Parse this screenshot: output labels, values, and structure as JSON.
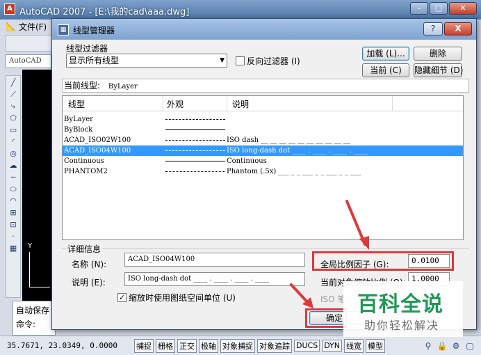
{
  "app": {
    "title": "AutoCAD 2007 - [E:\\我的cad\\aaa.dwg]",
    "menu_file": "文件(F)",
    "style_box": "AutoCAD",
    "y_axis": "Y"
  },
  "command_area": {
    "line1": "自动保存",
    "line2": "命令:"
  },
  "status_bar": {
    "coords": "35.7671, 23.0349, 0.0000",
    "buttons": [
      "捕捉",
      "栅格",
      "正交",
      "极轴",
      "对象捕捉",
      "对象追踪",
      "DUCS",
      "DYN",
      "线宽",
      "模型"
    ]
  },
  "dialog": {
    "title": "线型管理器",
    "filter_label": "线型过滤器",
    "filter_value": "显示所有线型",
    "invert_filter": "反向过滤器 (I)",
    "load_button": "加载 (L)...",
    "delete_button": "删除",
    "current_button": "当前 (C)",
    "hide_details_button": "隐藏细节 (D)",
    "current_linetype_label": "当前线型:",
    "current_linetype_value": "ByLayer",
    "columns": {
      "linetype": "线型",
      "appearance": "外观",
      "description": "说明"
    },
    "rows": [
      {
        "name": "ByLayer",
        "pattern": "dash",
        "desc": ""
      },
      {
        "name": "ByBlock",
        "pattern": "solid",
        "desc": ""
      },
      {
        "name": "ACAD_ISO02W100",
        "pattern": "dash",
        "desc": "ISO dash __ __ __ __ __ __ __ __ __ __"
      },
      {
        "name": "ACAD_ISO04W100",
        "pattern": "dash",
        "desc": "ISO long-dash dot ____ . ____ . ____ . ____"
      },
      {
        "name": "Continuous",
        "pattern": "solid",
        "desc": "Continuous"
      },
      {
        "name": "PHANTOM2",
        "pattern": "dot",
        "desc": "Phantom (.5x) ___ _ _ ___ _ _ ___ _ _ ___"
      }
    ],
    "details_label": "详细信息",
    "name_label": "名称 (N):",
    "name_value": "ACAD_ISO04W100",
    "desc_label": "说明 (E):",
    "desc_value": "ISO long-dash dot ____ . ____ . ____ . ____",
    "paper_space_check": "缩放时使用图纸空间单位 (U)",
    "global_scale_label": "全局比例因子 (G):",
    "global_scale_value": "0.0100",
    "current_scale_label": "当前对象缩放比例 (O):",
    "current_scale_value": "1.0000",
    "iso_pen_label": "ISO 笔",
    "ok_button": "确定",
    "help_glyph": "?",
    "close_glyph": "X"
  },
  "watermark": {
    "brand": "百科全说",
    "tagline": "助你轻松解决"
  },
  "colors": {
    "selection": "#3399ff",
    "highlight_red": "#e0383a",
    "brand_green": "#1e9a57"
  }
}
